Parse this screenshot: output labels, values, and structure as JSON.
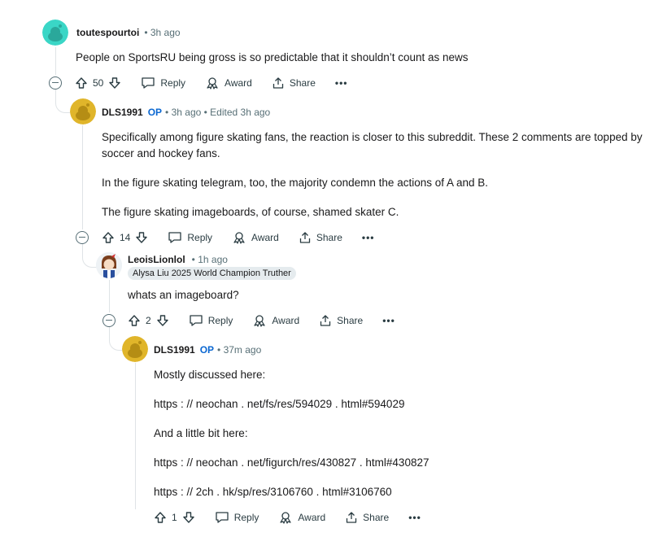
{
  "comments": [
    {
      "author": "toutespourtoi",
      "op_badge": "",
      "meta": "• 3h ago",
      "body": [
        "People on SportsRU being gross is so predictable that it shouldn’t count as news"
      ],
      "score": "50"
    },
    {
      "author": "DLS1991",
      "op_badge": "OP",
      "meta": "• 3h ago • Edited 3h ago",
      "body": [
        "Specifically among figure skating fans, the reaction is closer to this subreddit. These 2 comments are topped by soccer and hockey fans.",
        "In the figure skating telegram, too, the majority condemn the actions of A and B.",
        "The figure skating imageboards, of course, shamed skater C."
      ],
      "score": "14"
    },
    {
      "author": "LeoisLionlol",
      "op_badge": "",
      "meta": "• 1h ago",
      "flair": "Alysa Liu 2025 World Champion Truther",
      "body": [
        "whats an imageboard?"
      ],
      "score": "2"
    },
    {
      "author": "DLS1991",
      "op_badge": "OP",
      "meta": "• 37m ago",
      "body": [
        "Mostly discussed here:",
        "https : // neochan . net/fs/res/594029 . html#594029",
        "And a little bit here:",
        "https : // neochan . net/figurch/res/430827 . html#430827",
        "https : // 2ch . hk/sp/res/3106760 . html#3106760"
      ],
      "score": "1"
    }
  ],
  "actions": {
    "reply": "Reply",
    "award": "Award",
    "share": "Share",
    "more": "•••"
  },
  "icons": {
    "upvote": "upvote-arrow-icon",
    "downvote": "downvote-arrow-icon",
    "reply": "speech-bubble-icon",
    "award": "award-ribbon-icon",
    "share": "share-upload-icon",
    "collapse": "collapse-minus-icon"
  },
  "colors": {
    "op": "#0a67d1",
    "teal_avatar": "#3ad6c6",
    "gold_avatar": "#e0b52a",
    "meta": "#576f76"
  }
}
